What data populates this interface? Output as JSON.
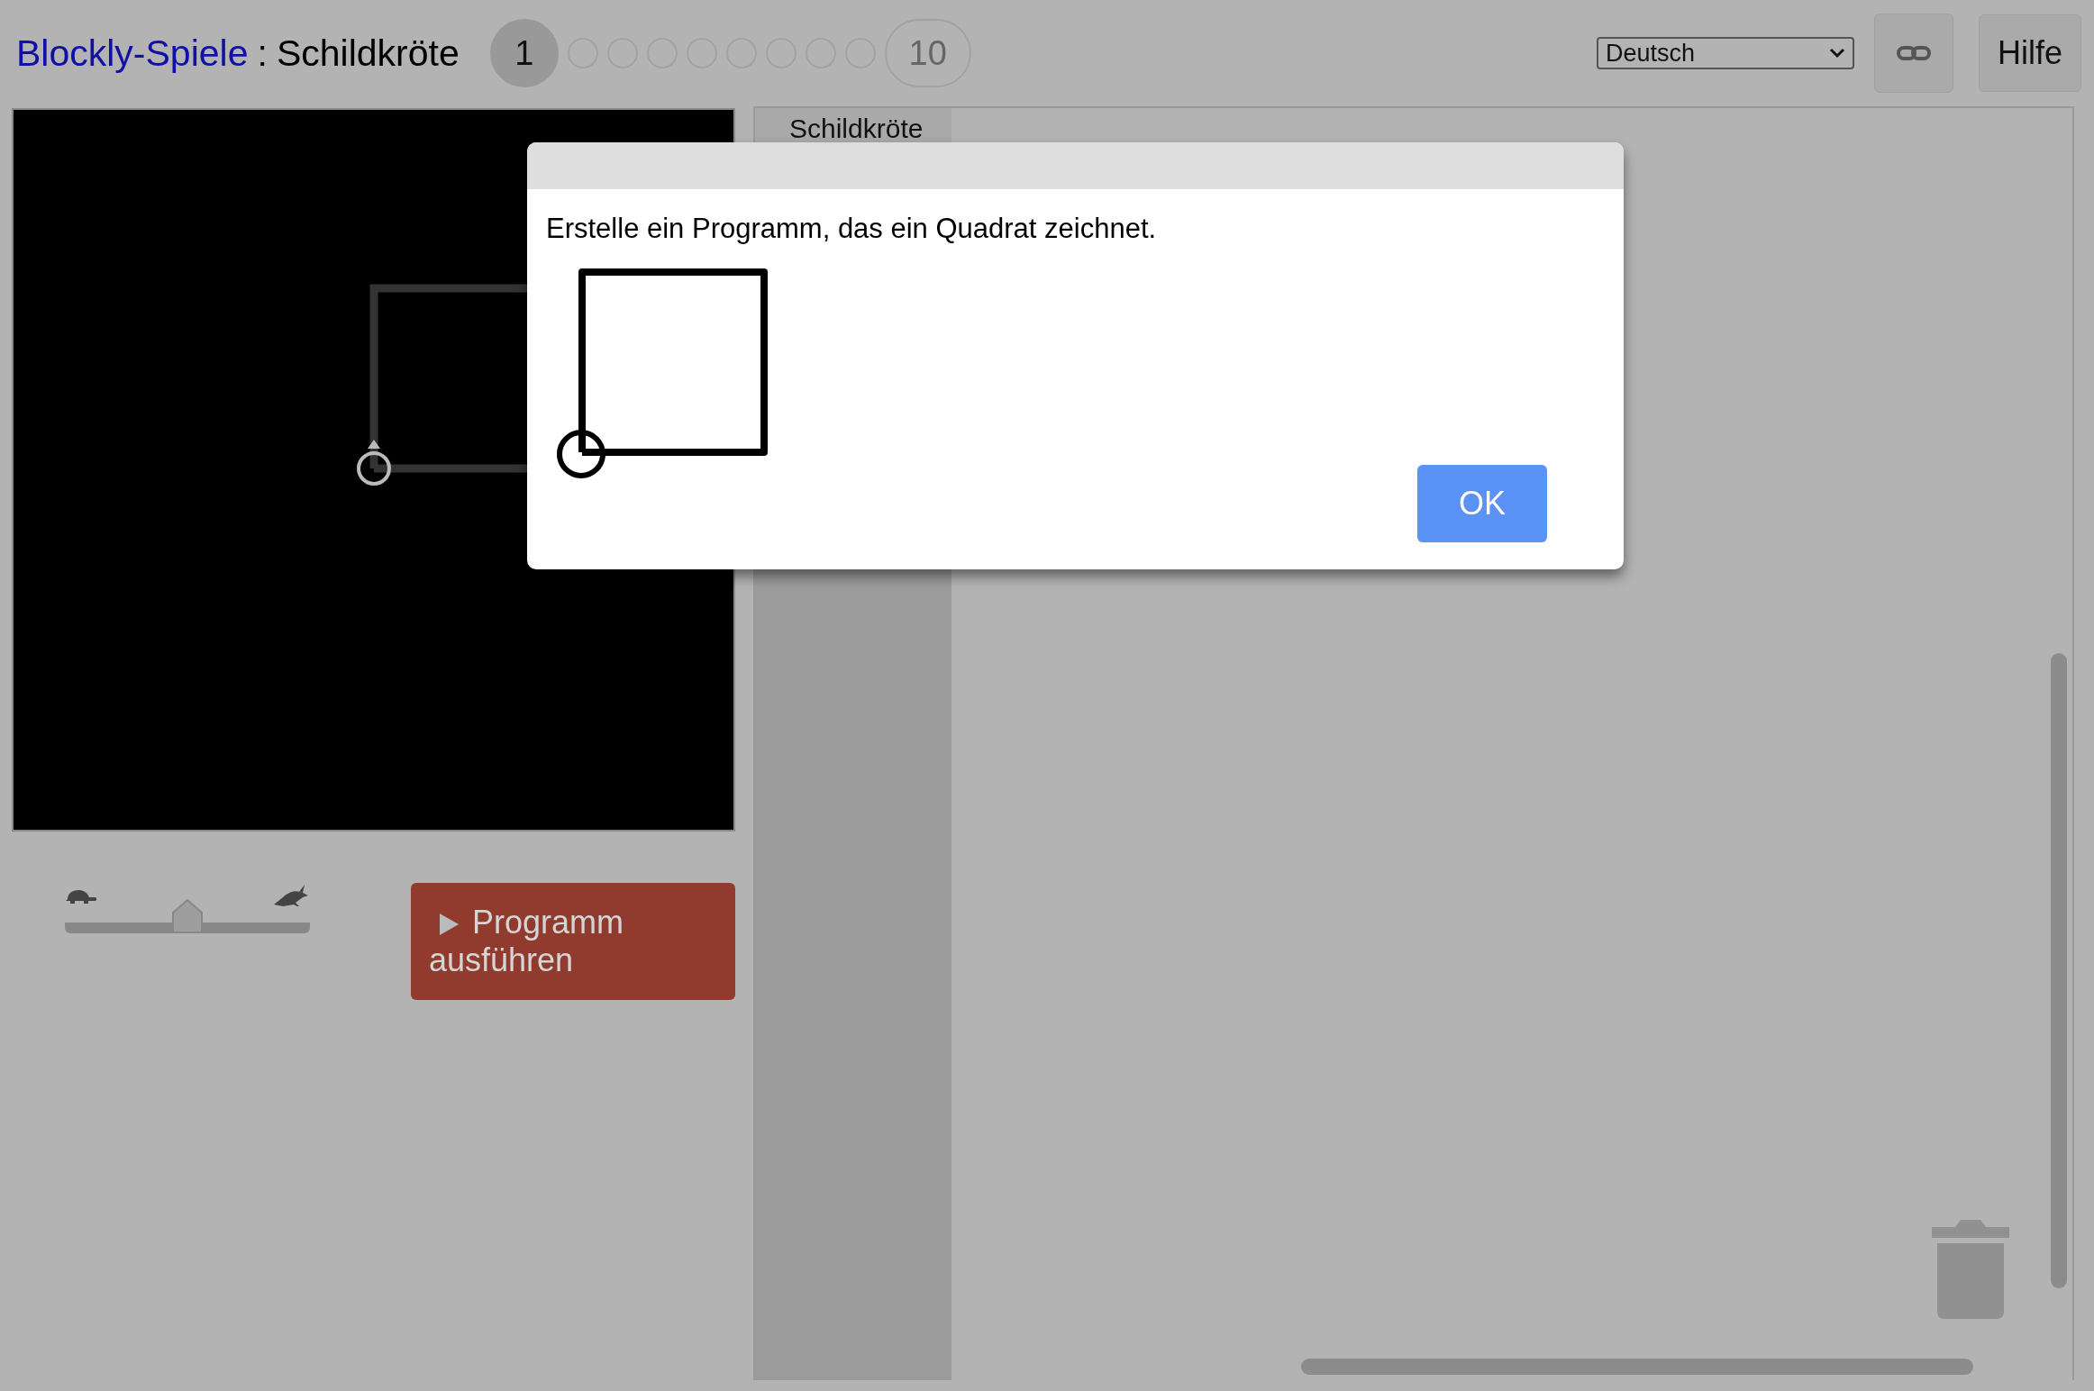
{
  "header": {
    "app_link": "Blockly-Spiele",
    "separator": ":",
    "title": "Schildkröte"
  },
  "levels": [
    {
      "label": "1",
      "selected": true
    },
    {
      "selected": false
    },
    {
      "selected": false
    },
    {
      "selected": false
    },
    {
      "selected": false
    },
    {
      "selected": false
    },
    {
      "selected": false
    },
    {
      "selected": false
    },
    {
      "selected": false
    },
    {
      "label": "10",
      "selected": false
    }
  ],
  "language_select": {
    "value": "Deutsch"
  },
  "help_button": {
    "label": "Hilfe"
  },
  "speed_slider": {
    "level": 0.5
  },
  "run_button": {
    "label": "Programm ausführen"
  },
  "toolbox": {
    "categories": [
      {
        "label": "Schildkröte"
      }
    ]
  },
  "dialog": {
    "message": "Erstelle ein Programm, das ein Quadrat zeichnet.",
    "ok_button": "OK"
  }
}
